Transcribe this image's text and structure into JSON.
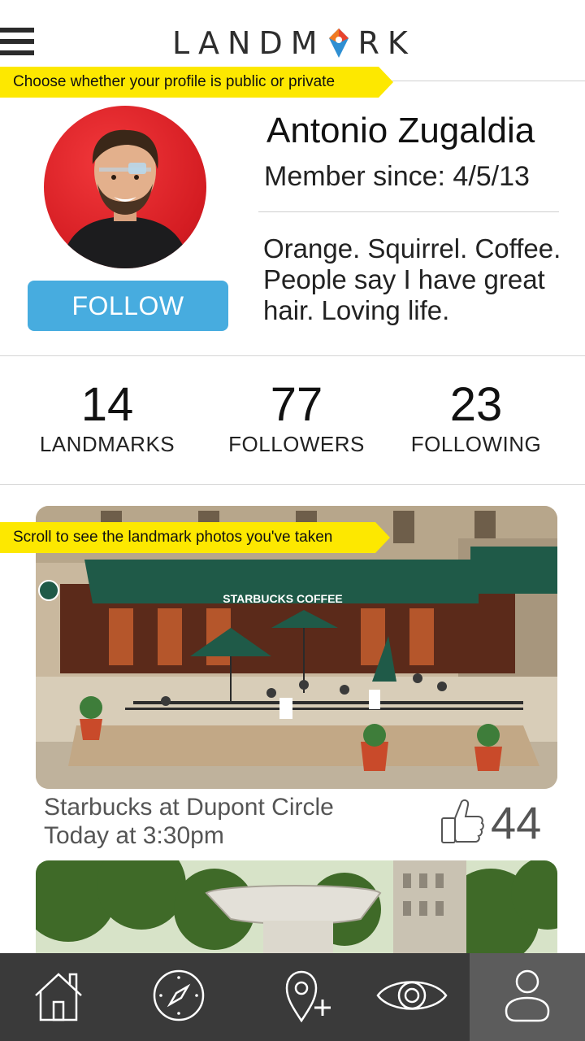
{
  "header": {
    "logo_text_left": "LANDM",
    "logo_text_right": "RK"
  },
  "tips": {
    "profile_privacy": "Choose whether your profile is public or private",
    "scroll_photos": "Scroll to see the landmark photos you've taken"
  },
  "profile": {
    "name": "Antonio Zugaldia",
    "member_since": "Member since: 4/5/13",
    "bio": "Orange. Squirrel. Coffee. People say I have great hair. Loving life.",
    "follow_label": "FOLLOW"
  },
  "stats": [
    {
      "value": "14",
      "label": "LANDMARKS"
    },
    {
      "value": "77",
      "label": "FOLLOWERS"
    },
    {
      "value": "23",
      "label": "FOLLOWING"
    }
  ],
  "feed": [
    {
      "sign_text": "STARBUCKS COFFEE",
      "title": "Starbucks at Dupont Circle",
      "time": "Today at 3:30pm",
      "likes": "44"
    },
    {
      "title": "",
      "time": ""
    }
  ],
  "nav": {
    "items": [
      {
        "icon": "home-icon"
      },
      {
        "icon": "compass-icon"
      },
      {
        "icon": "add-location-icon"
      },
      {
        "icon": "eye-icon"
      },
      {
        "icon": "profile-icon",
        "active": true
      }
    ]
  },
  "colors": {
    "accent_blue": "#47acdf",
    "tip_yellow": "#fde800",
    "nav_bg": "#3a3a3a",
    "nav_active": "#5c5c5c",
    "logo_pin_red": "#e8432e",
    "logo_pin_blue": "#2f8fd2"
  }
}
